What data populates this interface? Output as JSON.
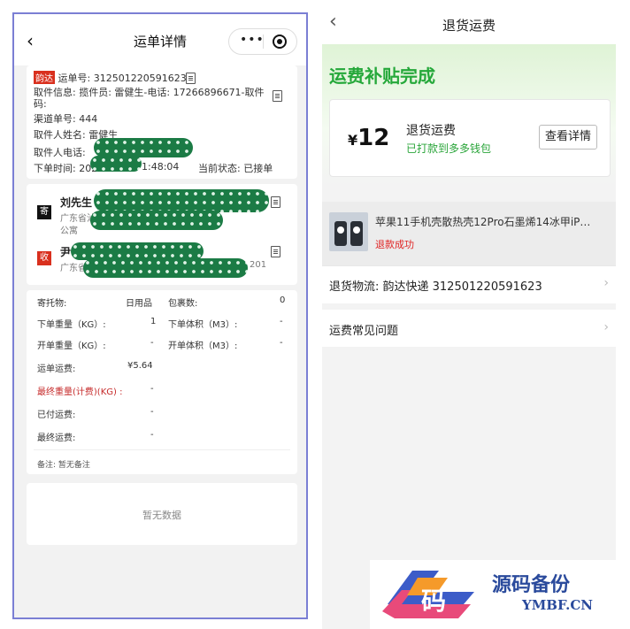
{
  "left": {
    "title": "运单详情",
    "capsule_dots": "•••",
    "order": {
      "carrier_tag": "韵达",
      "waybill_label": "运单号:",
      "waybill_no": "312501220591623",
      "pickup_info": "取件信息: 揽件员: 雷健生-电话: 17266896671-取件码:",
      "channel": "渠道单号: 444",
      "pickup_name": "取件人姓名: 雷健生",
      "pickup_phone": "取件人电话:",
      "order_time": "下单时间: 2024",
      "order_time_tail": "1:48:04",
      "status": "当前状态: 已接单"
    },
    "sender": {
      "tag": "寄",
      "name": "刘先生",
      "addr": "广东省汕头",
      "addr_tail": "公寓"
    },
    "receiver": {
      "tag": "收",
      "name": "尹",
      "addr": "广东省深",
      "addr_tail": "201"
    },
    "details": {
      "goods_label": "寄托物:",
      "goods_val": "日用品",
      "parcel_label": "包裹数:",
      "parcel_val": "0",
      "weight_label": "下单重量（KG）:",
      "weight_val": "1",
      "volume_label": "下单体积（M3）:",
      "volume_val": "-",
      "open_weight_label": "开单重量（KG）:",
      "open_weight_val": "-",
      "open_volume_label": "开单体积（M3）:",
      "open_volume_val": "-",
      "freight_label": "运单运费:",
      "freight_val": "¥5.64",
      "final_weight_label": "最终重量(计费)(KG) :",
      "final_weight_val": "-",
      "paid_label": "已付运费:",
      "paid_val": "-",
      "final_fee_label": "最终运费:",
      "final_fee_val": "-",
      "remark": "备注:  暂无备注"
    },
    "empty": "暂无数据"
  },
  "right": {
    "title": "退货运费",
    "banner": "运费补贴完成",
    "fee_currency": "¥",
    "fee_amount": "12",
    "fee_name": "退货运费",
    "fee_sub": "已打款到多多钱包",
    "detail_btn": "查看详情",
    "goods_name": "苹果11手机壳散热壳12Pro石墨烯14冰甲iP…",
    "goods_status": "退款成功",
    "logistics": "退货物流: 韵达快递 312501220591623",
    "faq": "运费常见问题"
  },
  "watermark": {
    "logo_char": "码",
    "cn": "源码备份",
    "en": "YMBF.CN"
  },
  "colors": {
    "green": "#25a83a",
    "red": "#d9301e",
    "frame": "#7b7fd4"
  }
}
